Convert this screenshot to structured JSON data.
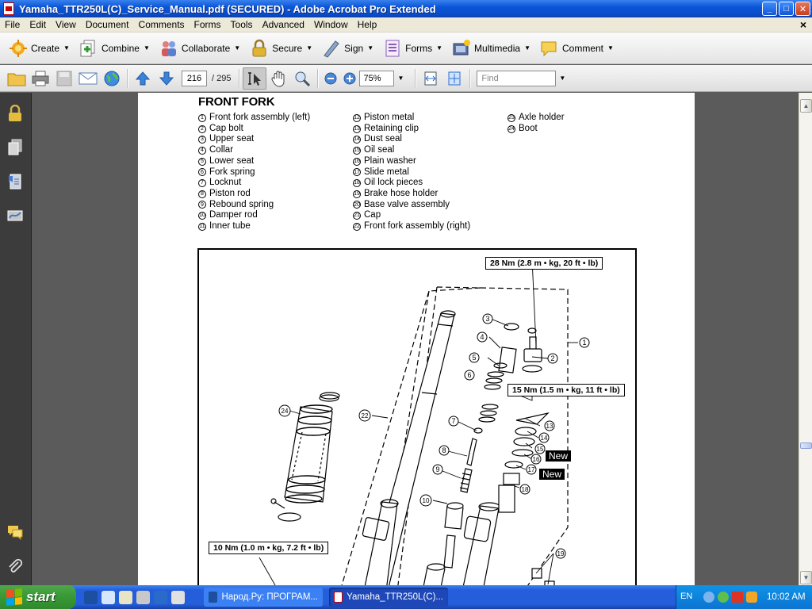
{
  "window": {
    "title": "Yamaha_TTR250L(C)_Service_Manual.pdf (SECURED) - Adobe Acrobat Pro Extended",
    "minimize": "_",
    "maximize": "□",
    "close": "✕"
  },
  "menu": [
    "File",
    "Edit",
    "View",
    "Document",
    "Comments",
    "Forms",
    "Tools",
    "Advanced",
    "Window",
    "Help"
  ],
  "menu_close": "×",
  "tasks": [
    {
      "label": "Create",
      "icon": "create-icon"
    },
    {
      "label": "Combine",
      "icon": "combine-icon"
    },
    {
      "label": "Collaborate",
      "icon": "collaborate-icon"
    },
    {
      "label": "Secure",
      "icon": "lock-icon"
    },
    {
      "label": "Sign",
      "icon": "pen-icon"
    },
    {
      "label": "Forms",
      "icon": "forms-icon"
    },
    {
      "label": "Multimedia",
      "icon": "multimedia-icon"
    },
    {
      "label": "Comment",
      "icon": "comment-icon"
    }
  ],
  "nav": {
    "page_current": "216",
    "page_total": "/ 295",
    "zoom": "75%",
    "find_placeholder": "Find"
  },
  "document": {
    "heading": "FRONT FORK",
    "parts_col1": [
      {
        "n": "1",
        "label": "Front fork assembly (left)"
      },
      {
        "n": "2",
        "label": "Cap bolt"
      },
      {
        "n": "3",
        "label": "Upper seat"
      },
      {
        "n": "4",
        "label": "Collar"
      },
      {
        "n": "5",
        "label": "Lower seat"
      },
      {
        "n": "6",
        "label": "Fork spring"
      },
      {
        "n": "7",
        "label": "Locknut"
      },
      {
        "n": "8",
        "label": "Piston rod"
      },
      {
        "n": "9",
        "label": "Rebound spring"
      },
      {
        "n": "10",
        "label": "Damper rod"
      },
      {
        "n": "11",
        "label": "Inner tube"
      }
    ],
    "parts_col2": [
      {
        "n": "12",
        "label": "Piston metal"
      },
      {
        "n": "13",
        "label": "Retaining clip"
      },
      {
        "n": "14",
        "label": "Dust seal"
      },
      {
        "n": "15",
        "label": "Oil seal"
      },
      {
        "n": "16",
        "label": "Plain washer"
      },
      {
        "n": "17",
        "label": "Slide metal"
      },
      {
        "n": "18",
        "label": "Oil lock pieces"
      },
      {
        "n": "19",
        "label": "Brake hose holder"
      },
      {
        "n": "20",
        "label": "Base valve assembly"
      },
      {
        "n": "21",
        "label": "Cap"
      },
      {
        "n": "22",
        "label": "Front fork assembly (right)"
      }
    ],
    "parts_col3": [
      {
        "n": "23",
        "label": "Axle holder"
      },
      {
        "n": "24",
        "label": "Boot"
      }
    ],
    "torque_top": "28 Nm (2.8 m • kg, 20 ft • lb)",
    "torque_mid": "15 Nm (1.5 m • kg, 11 ft • lb)",
    "torque_bottom": "10 Nm (1.0 m • kg, 7.2 ft • lb)",
    "new_tag_1": "New",
    "new_tag_2": "New",
    "diagram_callouts": [
      "1",
      "2",
      "3",
      "4",
      "5",
      "6",
      "7",
      "8",
      "9",
      "10",
      "13",
      "14",
      "15",
      "16",
      "17",
      "18",
      "19",
      "22",
      "24"
    ]
  },
  "taskbar": {
    "start": "start",
    "items": [
      {
        "label": "Народ.Ру: ПРОГРАМ...",
        "active": false
      },
      {
        "label": "Yamaha_TTR250L(C)...",
        "active": true
      }
    ],
    "lang": "EN",
    "clock": "10:02 AM"
  }
}
